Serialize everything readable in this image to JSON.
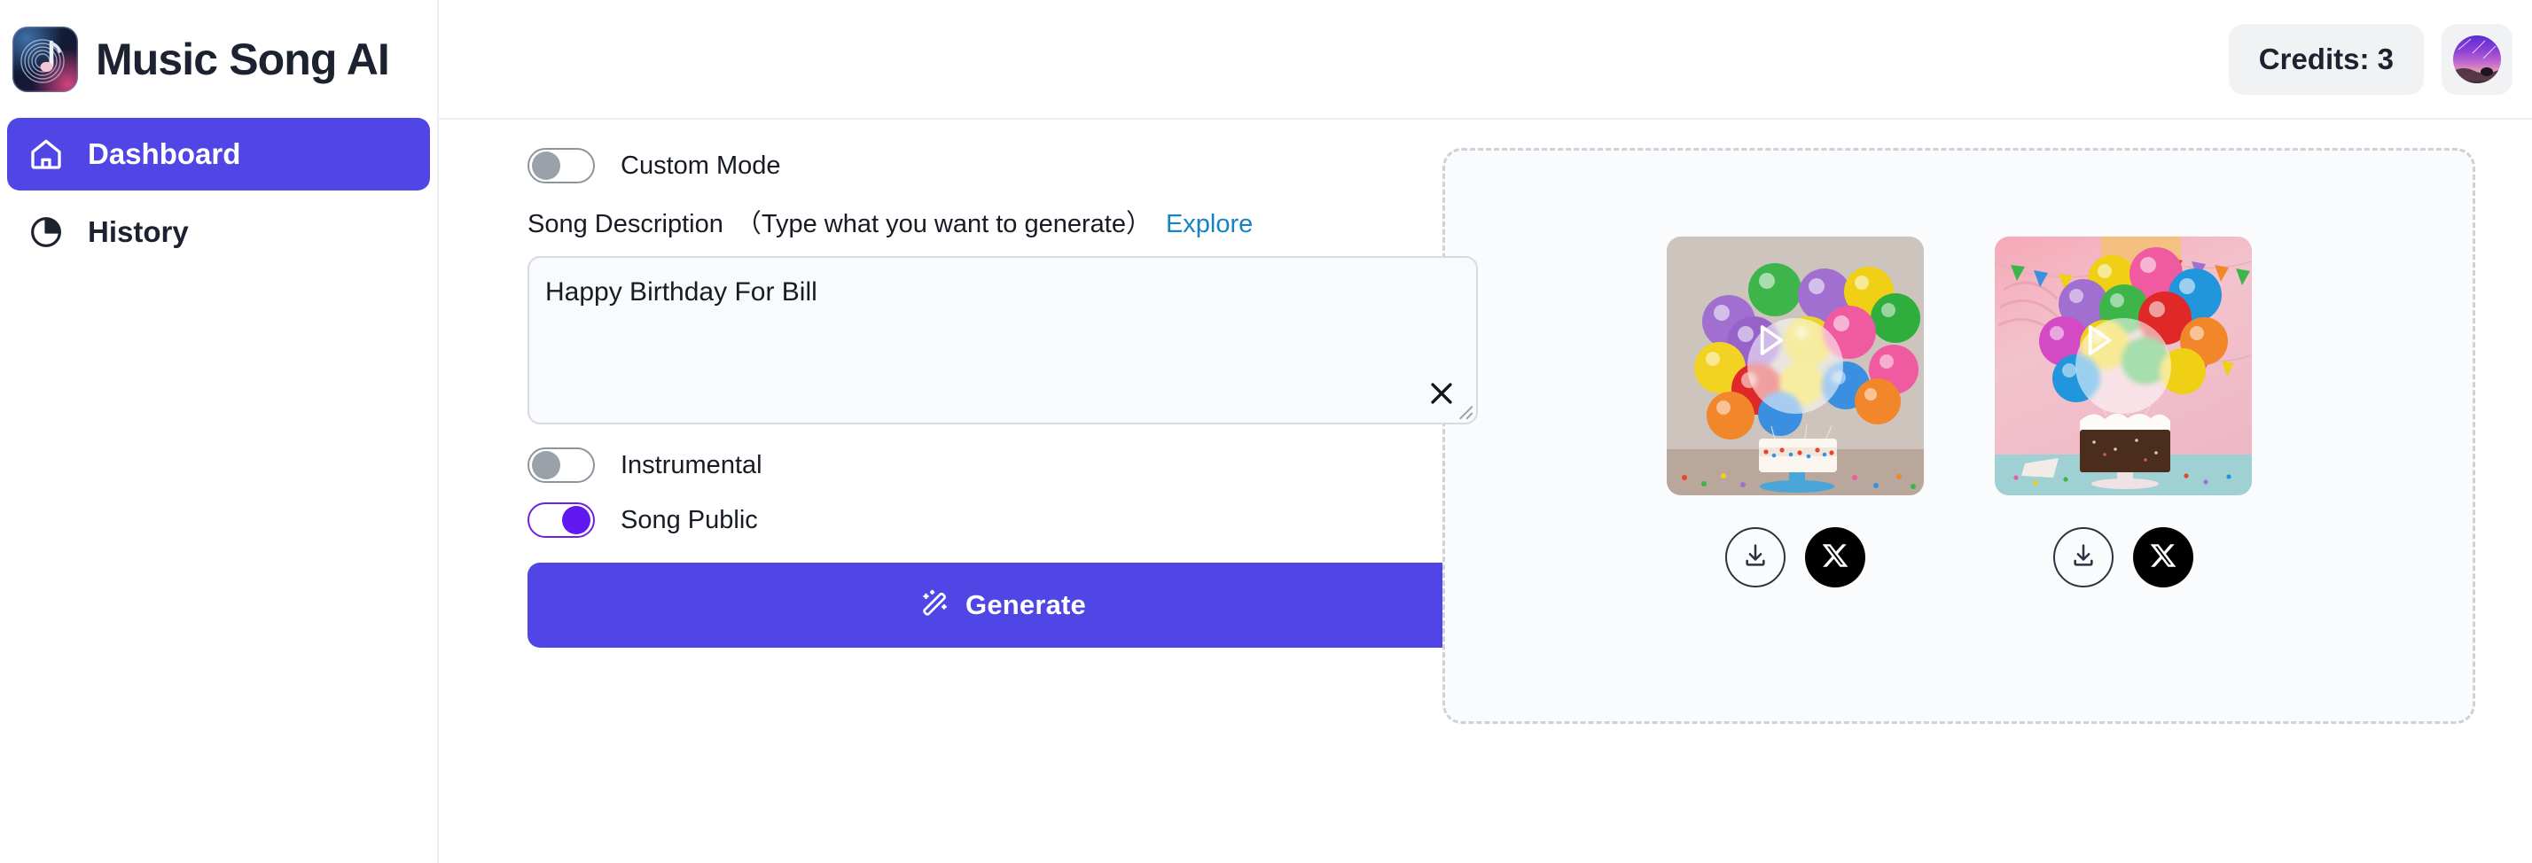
{
  "brand": {
    "title": "Music Song AI",
    "logo_icon": "music-note-vinyl-icon"
  },
  "sidebar": {
    "items": [
      {
        "label": "Dashboard",
        "icon": "home-icon",
        "active": true
      },
      {
        "label": "History",
        "icon": "pie-chart-icon",
        "active": false
      }
    ]
  },
  "topbar": {
    "credits_label": "Credits: 3",
    "avatar_icon": "user-avatar"
  },
  "form": {
    "custom_mode": {
      "label": "Custom Mode",
      "state": "off"
    },
    "description": {
      "label": "Song Description",
      "hint": "（Type what you want to generate）",
      "explore_link": "Explore",
      "value": "Happy Birthday For Bill",
      "placeholder": "Type what you want to generate",
      "clear_icon": "close-icon"
    },
    "instrumental": {
      "label": "Instrumental",
      "state": "off"
    },
    "song_public": {
      "label": "Song Public",
      "state": "on"
    },
    "generate": {
      "label": "Generate",
      "icon": "magic-wand-icon"
    }
  },
  "results": {
    "tracks": [
      {
        "thumbnail_alt": "white birthday cake with colorful balloons",
        "play_icon": "play-icon",
        "download_label": "download-icon",
        "share_label": "x-twitter-icon"
      },
      {
        "thumbnail_alt": "chocolate birthday cake with balloons and bunting",
        "play_icon": "play-icon",
        "download_label": "download-icon",
        "share_label": "x-twitter-icon"
      }
    ]
  },
  "colors": {
    "accent": "#4f46e5",
    "toggle_on": "#6218f0",
    "link": "#1583c4",
    "text": "#171b24",
    "panel_bg": "#fafbfc"
  }
}
